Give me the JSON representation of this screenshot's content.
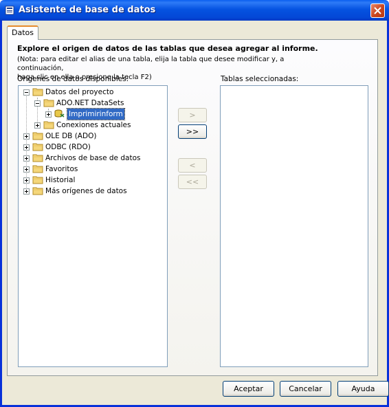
{
  "window": {
    "title": "Asistente de base de datos"
  },
  "tabs": [
    {
      "label": "Datos"
    }
  ],
  "header": {
    "heading": "Explore el origen de datos de las tablas que desea agregar al informe.",
    "note_line1": "(Nota: para editar el alias de una tabla, elija la tabla que desee modificar y, a continuación,",
    "note_line2": "haga clic en ella o presione la tecla F2)"
  },
  "sources": {
    "label": "Orígenes de datos disponibles:",
    "tree": {
      "project": "Datos del proyecto",
      "adonet": "ADO.NET DataSets",
      "selected_item": "Imprimirinform",
      "current_connections": "Conexiones actuales",
      "oledb": "OLE DB (ADO)",
      "odbc": "ODBC (RDO)",
      "db_files": "Archivos de base de datos",
      "favorites": "Favoritos",
      "history": "Historial",
      "more_sources": "Más orígenes de datos"
    }
  },
  "selected_tables": {
    "label": "Tablas seleccionadas:"
  },
  "transfer": {
    "add": ">",
    "add_all": ">>",
    "remove": "<",
    "remove_all": "<<"
  },
  "footer": {
    "ok": "Aceptar",
    "cancel": "Cancelar",
    "help": "Ayuda"
  },
  "colors": {
    "title_bar": "#0553E1",
    "selection": "#316AC5",
    "dialog": "#ECE9D8"
  }
}
